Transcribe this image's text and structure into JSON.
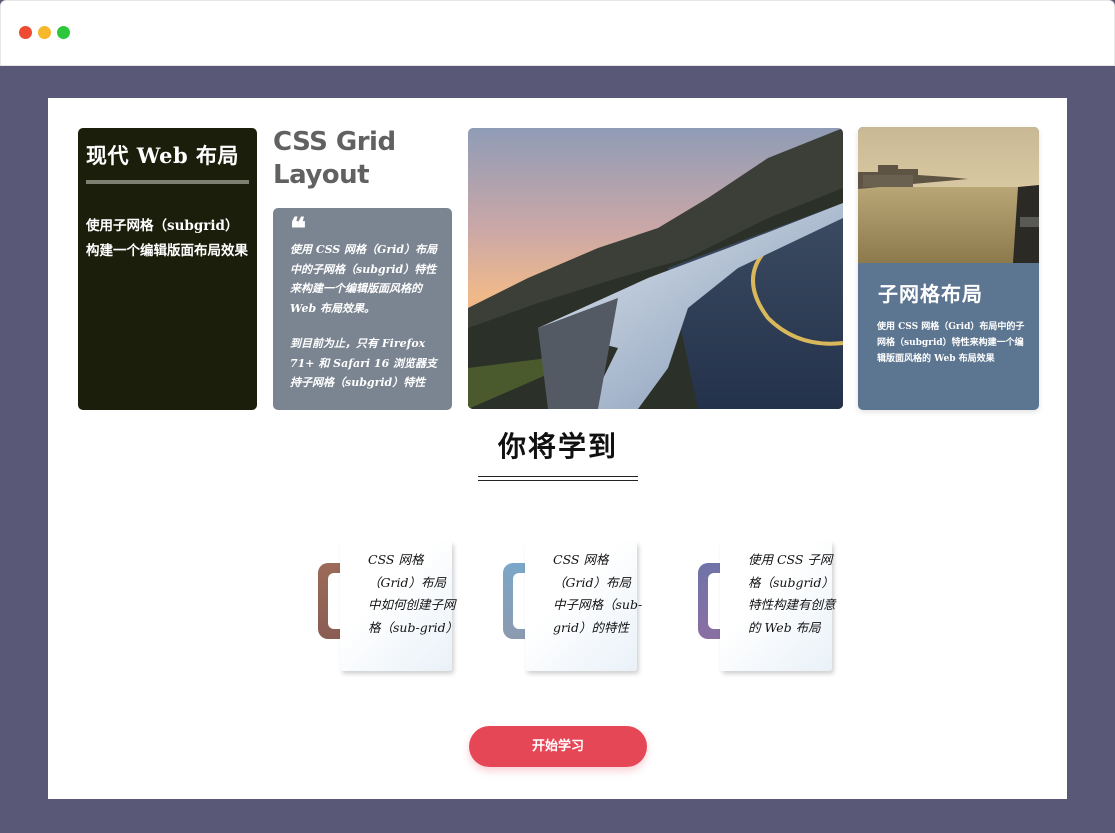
{
  "window": {
    "controls": [
      "close",
      "minimize",
      "maximize"
    ]
  },
  "hero": {
    "dark_card": {
      "title": "现代 Web 布局",
      "text": "使用子网格（subgrid）构建一个编辑版面布局效果"
    },
    "grid_heading": "CSS Grid Layout",
    "quote_card": {
      "quote_mark": "❝",
      "para1": "使用 CSS 网格（Grid）布局中的子网格（subgrid）特性来构建一个编辑版面风格的 Web 布局效果。",
      "para2": "到目前为止，只有 Firefox 71+ 和 Safari 16 浏览器支持子网格（subgrid）特性"
    },
    "city_card": {
      "title": "子网格布局",
      "text": "使用 CSS 网格（Grid）布局中的子网格（subgrid）特性来构建一个编辑版面风格的 Web 布局效果"
    }
  },
  "learn": {
    "title": "你将学到",
    "features": [
      {
        "text": "CSS 网格（Grid）布局中如何创建子网格（sub-grid）"
      },
      {
        "text": "CSS 网格（Grid）布局中子网格（sub-grid）的特性"
      },
      {
        "text": "使用 CSS 子网格（subgrid）特性构建有创意的 Web 布局"
      }
    ]
  },
  "cta": {
    "label": "开始学习"
  },
  "colors": {
    "frame_bg": "#5a5877",
    "dark_card": "#1b1e0b",
    "quote_card": "#7b8591",
    "city_card": "#5c7590",
    "button": "#e54757"
  }
}
